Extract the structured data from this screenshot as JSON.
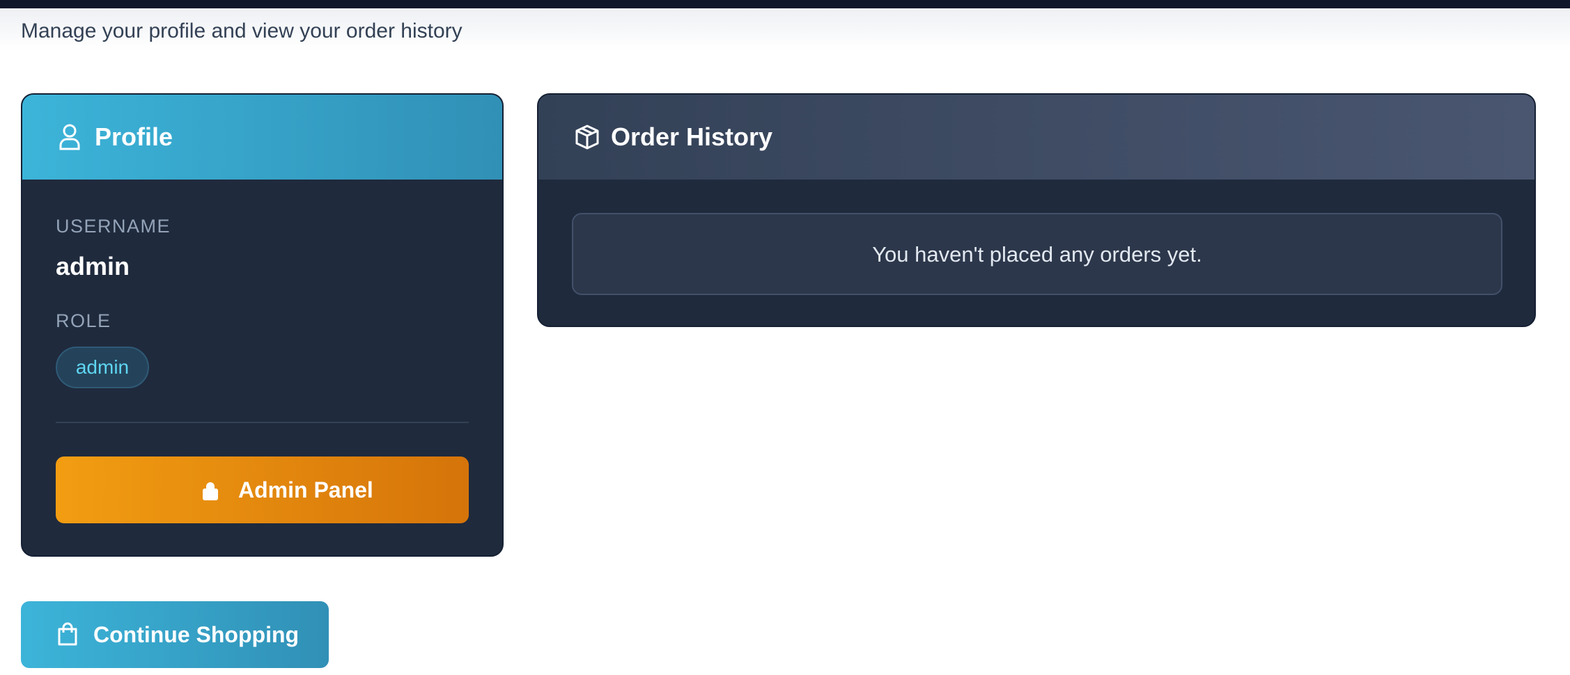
{
  "page": {
    "subtitle": "Manage your profile and view your order history"
  },
  "profile": {
    "title": "Profile",
    "icon": "user-icon",
    "username_label": "USERNAME",
    "username": "admin",
    "role_label": "ROLE",
    "role": "admin",
    "admin_button_label": "Admin Panel",
    "admin_button_icon": "lock-icon"
  },
  "orders": {
    "title": "Order History",
    "icon": "package-icon",
    "empty_message": "You haven't placed any orders yet."
  },
  "actions": {
    "continue_shopping_label": "Continue Shopping",
    "continue_shopping_icon": "shopping-bag-icon"
  },
  "colors": {
    "accent": "#3cb4d9",
    "admin_button": "#f29d12",
    "card_background": "#1f2a3d",
    "badge_text": "#5fd6f2"
  }
}
